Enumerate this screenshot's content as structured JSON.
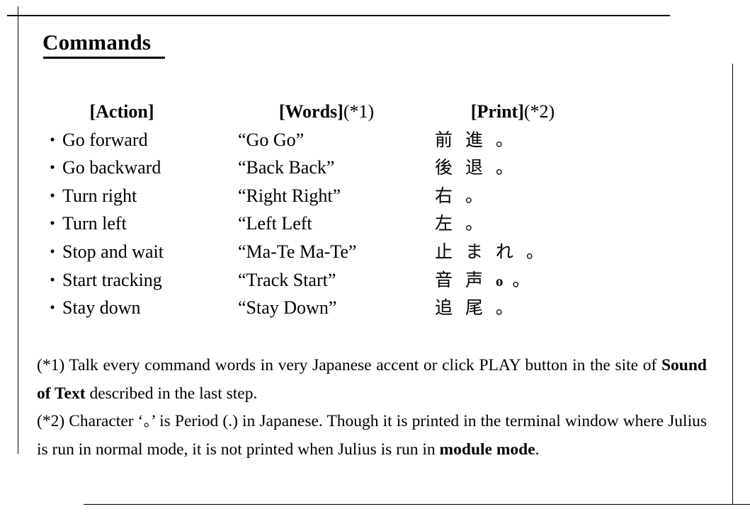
{
  "page": {
    "title": "Commands"
  },
  "table": {
    "headers": {
      "action": {
        "label": "[Action]",
        "note": ""
      },
      "words": {
        "label": "[Words]",
        "note": "(*1)"
      },
      "print": {
        "label": "[Print]",
        "note": "(*2)"
      }
    },
    "bullet": "・",
    "rows": [
      {
        "action": "Go forward",
        "words": "“Go Go”",
        "print_jp": "前 進 。",
        "print_latin": "",
        "print_tail": ""
      },
      {
        "action": "Go backward",
        "words": "“Back Back”",
        "print_jp": "後 退 。",
        "print_latin": "",
        "print_tail": ""
      },
      {
        "action": "Turn right",
        "words": "“Right Right”",
        "print_jp": "右 。",
        "print_latin": "",
        "print_tail": ""
      },
      {
        "action": "Turn left",
        "words": "“Left Left",
        "print_jp": "左 。",
        "print_latin": "",
        "print_tail": ""
      },
      {
        "action": "Stop and wait",
        "words": "“Ma-Te Ma-Te”",
        "print_jp": "止 ま れ 。",
        "print_latin": "",
        "print_tail": ""
      },
      {
        "action": "Start tracking",
        "words": "“Track Start”",
        "print_jp": "音 声 ",
        "print_latin": "o",
        "print_tail": " 。"
      },
      {
        "action": "Stay down",
        "words": "“Stay Down”",
        "print_jp": "追 尾 。",
        "print_latin": "",
        "print_tail": ""
      }
    ]
  },
  "notes": {
    "note1": {
      "lead": "(*1) Talk every command words in very Japanese accent or click PLAY button in the site of ",
      "bold": "Sound of Text",
      "tail": " described in the last step."
    },
    "note2": {
      "lead": "(*2) Character ‘",
      "jp_char": "。",
      "mid": "’ is Period (.) in Japanese. Though it is printed in the terminal window where Julius is run in normal mode, it is not printed when Julius is run in ",
      "bold": "module mode",
      "tail": "."
    }
  }
}
